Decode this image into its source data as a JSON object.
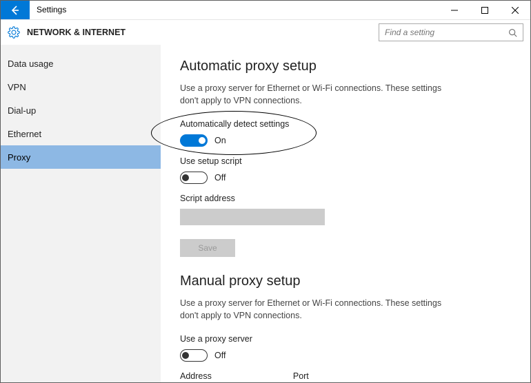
{
  "window": {
    "title": "Settings"
  },
  "header": {
    "title": "NETWORK & INTERNET",
    "search_placeholder": "Find a setting"
  },
  "sidebar": {
    "items": [
      {
        "label": "Data usage",
        "selected": false
      },
      {
        "label": "VPN",
        "selected": false
      },
      {
        "label": "Dial-up",
        "selected": false
      },
      {
        "label": "Ethernet",
        "selected": false
      },
      {
        "label": "Proxy",
        "selected": true
      }
    ]
  },
  "content": {
    "auto": {
      "title": "Automatic proxy setup",
      "desc": "Use a proxy server for Ethernet or Wi-Fi connections. These settings don't apply to VPN connections.",
      "detect_label": "Automatically detect settings",
      "detect_state": "On",
      "script_label": "Use setup script",
      "script_state": "Off",
      "script_addr_label": "Script address",
      "script_addr_value": "",
      "save_label": "Save"
    },
    "manual": {
      "title": "Manual proxy setup",
      "desc": "Use a proxy server for Ethernet or Wi-Fi connections. These settings don't apply to VPN connections.",
      "use_label": "Use a proxy server",
      "use_state": "Off",
      "address_label": "Address",
      "port_label": "Port"
    }
  }
}
